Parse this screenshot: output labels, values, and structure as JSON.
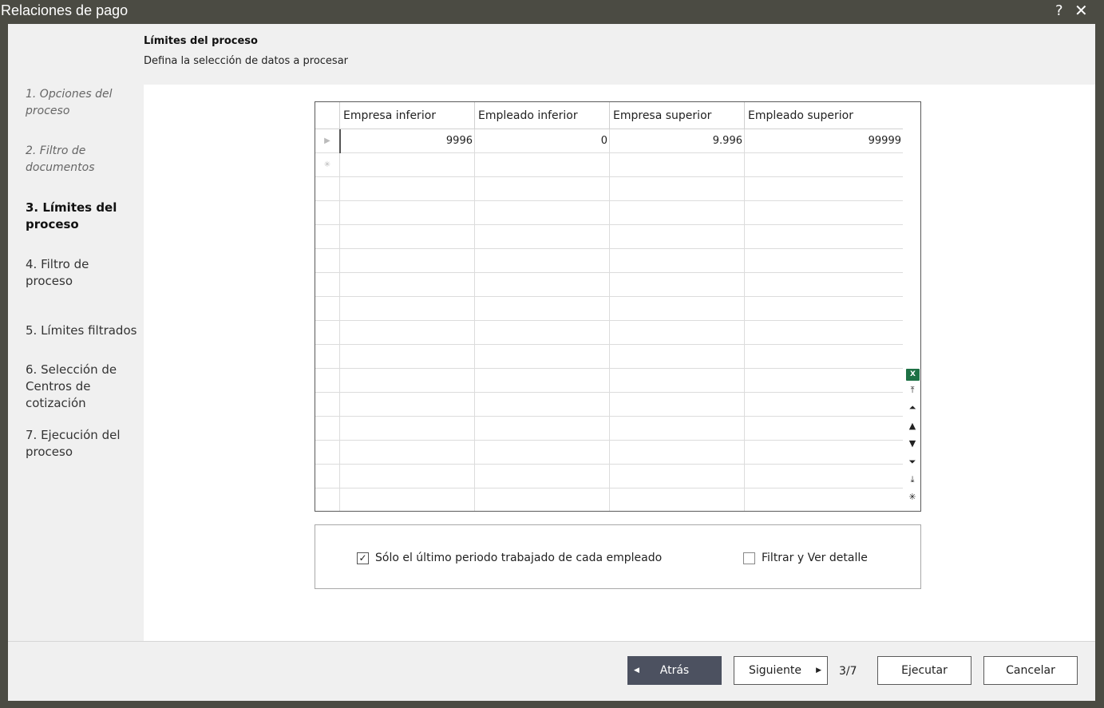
{
  "window": {
    "title": "Relaciones de pago",
    "help": "?",
    "close": "✕"
  },
  "header": {
    "title": "Límites del proceso",
    "subtitle": "Defina la selección de datos a procesar"
  },
  "steps": [
    {
      "label": "1. Opciones del proceso",
      "state": "done"
    },
    {
      "label": "2. Filtro de documentos",
      "state": "done"
    },
    {
      "label": "3. Límites del proceso",
      "state": "current"
    },
    {
      "label": "4. Filtro de proceso",
      "state": "pending"
    },
    {
      "label": "5. Límites filtrados",
      "state": "pending"
    },
    {
      "label": "6. Selección de Centros de cotización",
      "state": "pending"
    },
    {
      "label": "7. Ejecución del proceso",
      "state": "pending"
    }
  ],
  "grid": {
    "columns": [
      "Empresa inferior",
      "Empleado inferior",
      "Empresa superior",
      "Empleado superior"
    ],
    "rows": [
      [
        "9996",
        "0",
        "9.996",
        "99999"
      ]
    ],
    "current_row_marker": "▶",
    "new_row_marker": "✳"
  },
  "grid_tools": [
    {
      "icon": "excel-export-icon",
      "glyph": "X"
    },
    {
      "icon": "first-record-icon",
      "glyph": "⤒"
    },
    {
      "icon": "previous-page-icon",
      "glyph": "⏶"
    },
    {
      "icon": "previous-record-icon",
      "glyph": "▲"
    },
    {
      "icon": "next-record-icon",
      "glyph": "▼"
    },
    {
      "icon": "next-page-icon",
      "glyph": "⏷"
    },
    {
      "icon": "last-record-icon",
      "glyph": "⤓"
    },
    {
      "icon": "new-record-icon",
      "glyph": "✳"
    }
  ],
  "options": {
    "last_period": {
      "label": "Sólo el último periodo trabajado de cada empleado",
      "checked": true
    },
    "filter_detail": {
      "label": "Filtrar y Ver detalle",
      "checked": false
    }
  },
  "footer": {
    "back": "Atrás",
    "next": "Siguiente",
    "page": "3/7",
    "execute": "Ejecutar",
    "cancel": "Cancelar"
  }
}
